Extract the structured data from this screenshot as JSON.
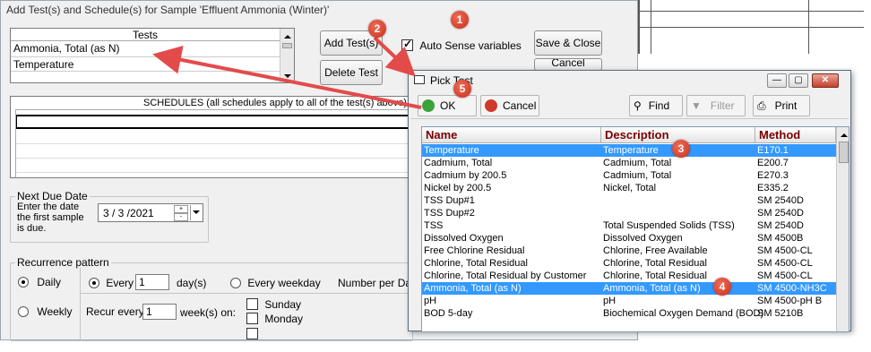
{
  "main": {
    "title": "Add Test(s) and Schedule(s) for Sample 'Effluent Ammonia (Winter)'",
    "tests_header": "Tests",
    "tests": [
      "Ammonia, Total (as N)",
      "Temperature"
    ],
    "add_tests_label": "Add Test(s)",
    "delete_test_label": "Delete Test",
    "auto_sense_label": "Auto Sense variables",
    "save_close_label": "Save & Close",
    "cancel_label": "Cancel",
    "schedules_header": "SCHEDULES (all schedules apply to all of the test(s) above)",
    "next_due": {
      "group_label": "Next Due Date",
      "prompt": "Enter the date the first sample is due.",
      "date_value": "3 / 3 /2021"
    },
    "recurrence": {
      "group_label": "Recurrence pattern",
      "daily_label": "Daily",
      "weekly_label": "Weekly",
      "every_label": "Every",
      "every_value": "1",
      "days_label": "day(s)",
      "every_weekday_label": "Every weekday",
      "number_per_day_label": "Number per Day",
      "recur_every_label": "Recur every",
      "recur_value": "1",
      "weeks_on_label": "week(s) on:",
      "sunday_label": "Sunday",
      "monday_label": "Monday"
    }
  },
  "pick": {
    "title": "Pick Test",
    "ok_label": "OK",
    "cancel_label": "Cancel",
    "find_label": "Find",
    "filter_label": "Filter",
    "print_label": "Print",
    "columns": [
      "Name",
      "Description",
      "Method"
    ],
    "rows": [
      {
        "name": "Temperature",
        "description": "Temperature",
        "method": "E170.1",
        "selected": true
      },
      {
        "name": "Cadmium, Total",
        "description": "Cadmium, Total",
        "method": "E200.7",
        "selected": false
      },
      {
        "name": "Cadmium by 200.5",
        "description": "Cadmium, Total",
        "method": "E270.3",
        "selected": false
      },
      {
        "name": "Nickel by 200.5",
        "description": "Nickel, Total",
        "method": "E335.2",
        "selected": false
      },
      {
        "name": "TSS Dup#1",
        "description": "",
        "method": "SM 2540D",
        "selected": false
      },
      {
        "name": "TSS Dup#2",
        "description": "",
        "method": "SM 2540D",
        "selected": false
      },
      {
        "name": "TSS",
        "description": "Total Suspended Solids (TSS)",
        "method": "SM 2540D",
        "selected": false
      },
      {
        "name": "Dissolved Oxygen",
        "description": "Dissolved Oxygen",
        "method": "SM 4500B",
        "selected": false
      },
      {
        "name": "Free Chlorine Residual",
        "description": "Chlorine, Free Available",
        "method": "SM 4500-CL",
        "selected": false
      },
      {
        "name": "Chlorine, Total Residual",
        "description": "Chlorine, Total Residual",
        "method": "SM 4500-CL",
        "selected": false
      },
      {
        "name": "Chlorine, Total Residual by Customer",
        "description": "Chlorine, Total Residual",
        "method": "SM 4500-CL",
        "selected": false
      },
      {
        "name": "Ammonia, Total (as N)",
        "description": "Ammonia, Total (as N)",
        "method": "SM 4500-NH3C",
        "selected": true
      },
      {
        "name": "pH",
        "description": "pH",
        "method": "SM 4500-pH B",
        "selected": false
      },
      {
        "name": "BOD 5-day",
        "description": "Biochemical Oxygen Demand (BOD)",
        "method": "SM 5210B",
        "selected": false
      }
    ]
  },
  "badges": [
    "1",
    "2",
    "3",
    "4",
    "5"
  ],
  "colors": {
    "selection": "#3399ff",
    "badge": "#d9402a",
    "arrow": "#e34b4b",
    "header_text": "#7a0000"
  }
}
